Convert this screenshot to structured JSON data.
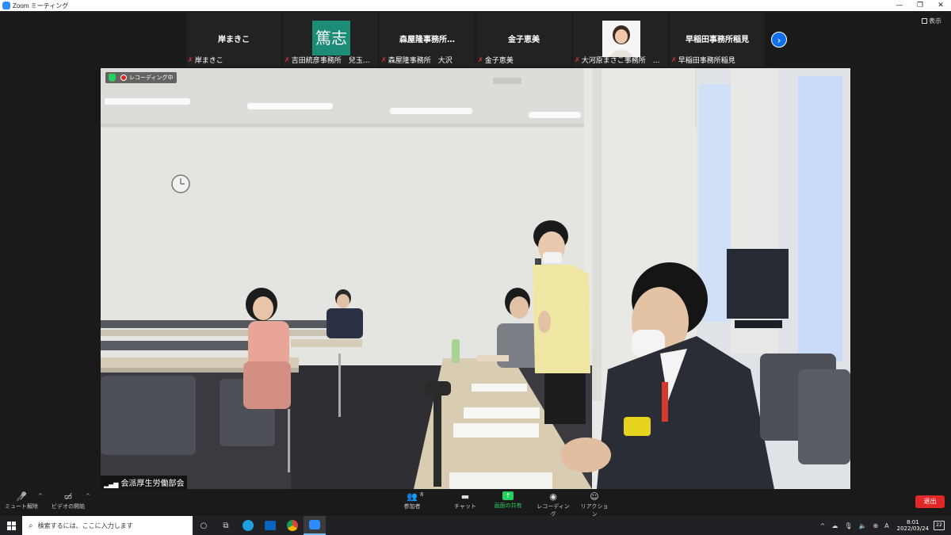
{
  "window": {
    "title": "Zoom ミーティング",
    "buttons": [
      "—",
      "❐",
      "✕"
    ]
  },
  "top_strip": {
    "view_label": "表示",
    "thumbnails": [
      {
        "center_name": "岸まきこ",
        "label": "岸まきこ",
        "muted": true
      },
      {
        "avatar_text": "篤志",
        "label": "吉田統彦事務所　兒玉…",
        "muted": true
      },
      {
        "center_name": "森屋隆事務所…",
        "label": "森屋隆事務所　大沢",
        "muted": true
      },
      {
        "center_name": "金子恵美",
        "label": "金子恵美",
        "muted": true
      },
      {
        "photo": true,
        "label": "大河原まさこ事務所　…",
        "muted": true
      },
      {
        "center_name": "早稲田事務所稲見",
        "label": "早稲田事務所稲見",
        "muted": true
      }
    ]
  },
  "main_video": {
    "recording_text": "レコーディング中",
    "speaker_name": "会派厚生労働部会"
  },
  "toolbar": {
    "unmute": "ミュート解除",
    "start_video": "ビデオの開始",
    "participants": "参加者",
    "participant_count": "8",
    "chat": "チャット",
    "share_screen": "画面の共有",
    "record": "レコーディング",
    "reactions": "リアクション",
    "leave": "退出"
  },
  "taskbar": {
    "search_placeholder": "検索するには、ここに入力します",
    "time": "8:01",
    "date": "2022/03/24",
    "ime": "A",
    "notifications": "22"
  }
}
